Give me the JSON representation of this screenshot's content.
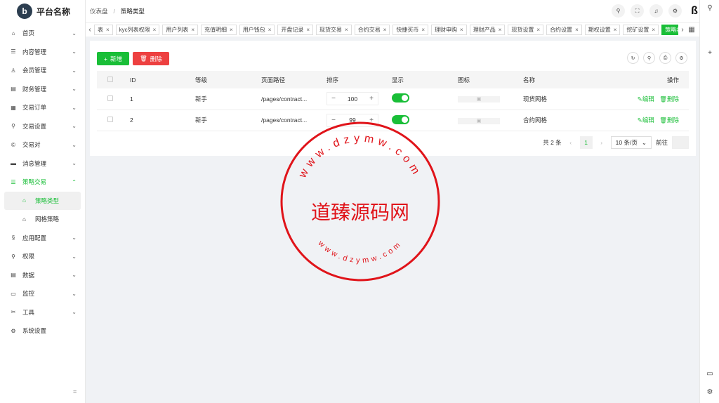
{
  "brand": {
    "logo_letter": "b",
    "title": "平台名称"
  },
  "sidebar": {
    "items": [
      {
        "icon": "⌂",
        "label": "首页"
      },
      {
        "icon": "☰",
        "label": "内容管理"
      },
      {
        "icon": "♙",
        "label": "会员管理"
      },
      {
        "icon": "▤",
        "label": "财务管理"
      },
      {
        "icon": "▦",
        "label": "交易订单"
      },
      {
        "icon": "⚲",
        "label": "交易设置"
      },
      {
        "icon": "©",
        "label": "交易对"
      },
      {
        "icon": "▬",
        "label": "消息管理"
      },
      {
        "icon": "☰",
        "label": "策略交易"
      }
    ],
    "subitems": [
      {
        "icon": "⌂",
        "label": "策略类型"
      },
      {
        "icon": "⌂",
        "label": "网格策略"
      }
    ],
    "items_after": [
      {
        "icon": "§",
        "label": "应用配置"
      },
      {
        "icon": "⚲",
        "label": "权限"
      },
      {
        "icon": "▤",
        "label": "数据"
      },
      {
        "icon": "▭",
        "label": "监控"
      },
      {
        "icon": "✂",
        "label": "工具"
      },
      {
        "icon": "⚙",
        "label": "系统设置"
      }
    ],
    "collapse_icon": "≡"
  },
  "breadcrumb": {
    "first": "仪表盘",
    "sep": "/",
    "second": "策略类型"
  },
  "top_icons": {
    "search": "⚲",
    "fullscreen": "⛶",
    "bell": "♫",
    "settings": "⚙",
    "brand": "ß"
  },
  "tabs": [
    {
      "label": "表"
    },
    {
      "label": "kyc列表权限"
    },
    {
      "label": "用户列表"
    },
    {
      "label": "充值明细"
    },
    {
      "label": "用户钱包"
    },
    {
      "label": "开盘记录"
    },
    {
      "label": "现货交易"
    },
    {
      "label": "合约交易"
    },
    {
      "label": "快捷买币"
    },
    {
      "label": "理财申购"
    },
    {
      "label": "理财产品"
    },
    {
      "label": "现货设置"
    },
    {
      "label": "合约设置"
    },
    {
      "label": "期权设置"
    },
    {
      "label": "挖矿设置"
    },
    {
      "label": "策略类型"
    }
  ],
  "tab_close": "×",
  "toolbar": {
    "add_label": "新增",
    "add_icon": "+",
    "delete_label": "删除",
    "delete_icon": "🗑"
  },
  "table": {
    "headers": [
      "ID",
      "等级",
      "页面路径",
      "排序",
      "显示",
      "图标",
      "名称",
      "操作"
    ],
    "rows": [
      {
        "id": "1",
        "level": "新手",
        "path": "/pages/contract...",
        "sort": "100",
        "icon": "▣",
        "name": "现货网格"
      },
      {
        "id": "2",
        "level": "新手",
        "path": "/pages/contract...",
        "sort": "99",
        "icon": "▣",
        "name": "合约网格"
      }
    ],
    "edit_label": "编辑",
    "delete_label": "删除"
  },
  "pager": {
    "total": "共 2 条",
    "page": "1",
    "size": "10 条/页",
    "goto": "前往"
  },
  "stamp": {
    "center": "道臻源码网",
    "ring": "www.dzymw.com"
  },
  "colors": {
    "accent": "#19be37",
    "danger": "#ed4040",
    "stamp": "#e0141a"
  }
}
